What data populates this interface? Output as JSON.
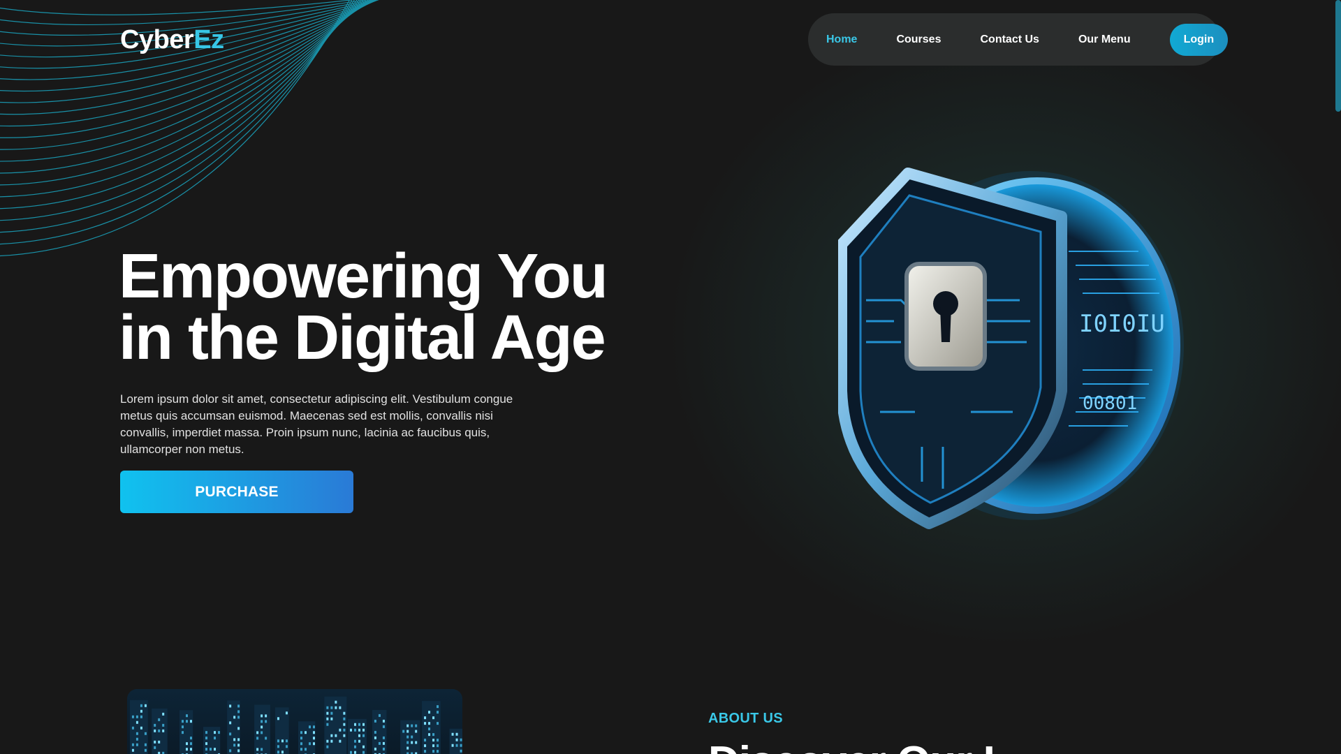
{
  "brand": {
    "logo_part1": "Cyber",
    "logo_part2": "Ez",
    "accent_color": "#3ac8e8"
  },
  "nav": {
    "items": [
      {
        "label": "Home",
        "active": true
      },
      {
        "label": "Courses",
        "active": false
      },
      {
        "label": "Contact Us",
        "active": false
      },
      {
        "label": "Our Menu",
        "active": false
      }
    ],
    "login_label": "Login"
  },
  "hero": {
    "title_line1": "Empowering You",
    "title_line2": "in the Digital Age",
    "body": "Lorem ipsum dolor sit amet, consectetur adipiscing elit. Vestibulum congue metus quis accumsan euismod. Maecenas sed est mollis, convallis nisi convallis, imperdiet massa. Proin ipsum nunc, lacinia ac faucibus quis, ullamcorper non metus.",
    "cta_label": "PURCHASE",
    "illustration_icon": "shield-lock-icon",
    "illustration_text": [
      "00801",
      "I0I0IU"
    ]
  },
  "about": {
    "label": "ABOUT US",
    "heading_partial": "Discover Our I"
  },
  "colors": {
    "background": "#181818",
    "nav_background": "#2b2d2d",
    "button_gradient_start": "#10c2ef",
    "button_gradient_end": "#2a7ad6"
  }
}
